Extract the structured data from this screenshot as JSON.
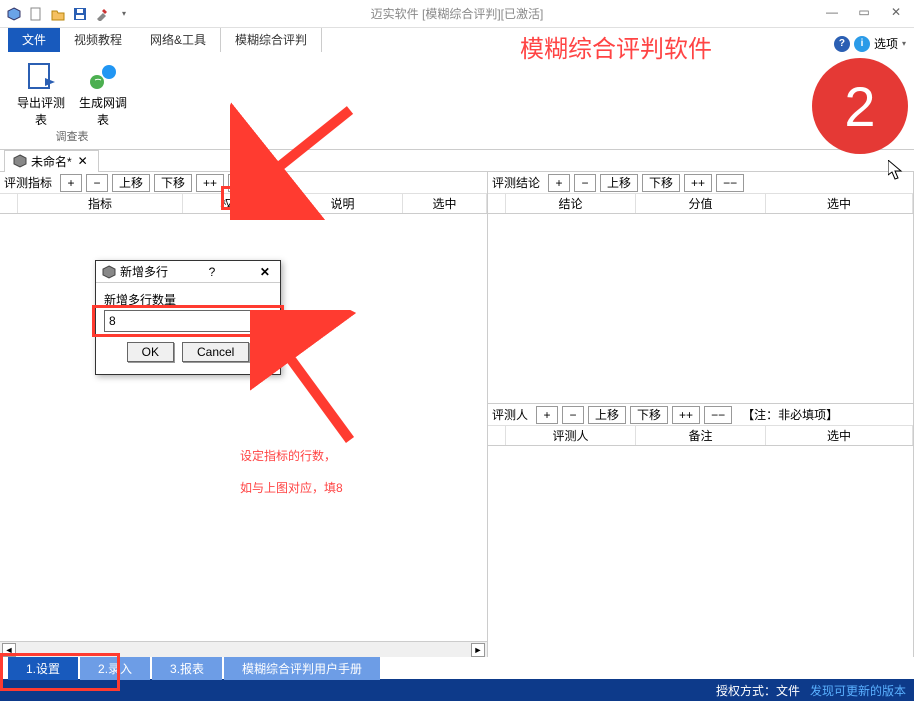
{
  "window": {
    "title": "迈实软件 [模糊综合评判][已激活]"
  },
  "ribbon": {
    "tabs": {
      "file": "文件",
      "video": "视频教程",
      "net": "网络&工具",
      "fuzzy": "模糊综合评判"
    },
    "options": "选项",
    "group1_name": "调查表",
    "btn_export": "导出评测表",
    "btn_generate": "生成网调表"
  },
  "doc": {
    "name": "未命名*"
  },
  "left_panel": {
    "label": "评测指标",
    "btns": {
      "add": "+",
      "sub": "−",
      "up": "上移",
      "down": "下移",
      "addmulti": "++",
      "submulti": "−−"
    },
    "cols": {
      "c1": "指标",
      "c2": "权重",
      "c3": "说明",
      "c4": "选中"
    }
  },
  "right_top": {
    "label": "评测结论",
    "btns": {
      "add": "+",
      "sub": "−",
      "up": "上移",
      "down": "下移",
      "addmulti": "++",
      "submulti": "−−"
    },
    "cols": {
      "c1": "结论",
      "c2": "分值",
      "c3": "选中"
    }
  },
  "right_bottom": {
    "label": "评测人",
    "btns": {
      "add": "+",
      "sub": "−",
      "up": "上移",
      "down": "下移",
      "addmulti": "++",
      "submulti": "−−"
    },
    "note": "【注：非必填项】",
    "cols": {
      "c1": "评测人",
      "c2": "备注",
      "c3": "选中"
    }
  },
  "dialog": {
    "title": "新增多行",
    "field_label": "新增多行数量",
    "value": "8",
    "ok": "OK",
    "cancel": "Cancel",
    "help": "?",
    "close": "✕"
  },
  "bottom_tabs": {
    "t1": "1.设置",
    "t2": "2.录入",
    "t3": "3.报表",
    "t4": "模糊综合评判用户手册"
  },
  "status": {
    "auth_label": "授权方式：",
    "auth_value": "文件",
    "update": "发现可更新的版本"
  },
  "anno": {
    "title": "模糊综合评判软件",
    "badge": "2",
    "text1": "设定指标的行数，",
    "text2": "如与上图对应，填8"
  }
}
